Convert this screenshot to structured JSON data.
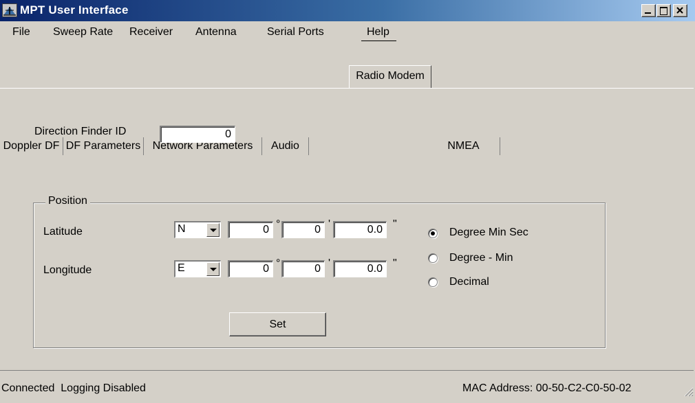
{
  "window": {
    "title": "MPT User Interface"
  },
  "menu": [
    "File",
    "Sweep Rate",
    "Receiver",
    "Antenna",
    "Serial Ports",
    "Help"
  ],
  "tabs": [
    "Doppler DF",
    "DF Parameters",
    "Network Parameters",
    "Audio",
    "Radio Modem",
    "NMEA"
  ],
  "selected_tab": "Radio Modem",
  "form": {
    "df_id_label": "Direction Finder ID",
    "df_id_value": "0",
    "position_group": "Position",
    "latitude": {
      "label": "Latitude",
      "hemisphere": "N",
      "deg": "0",
      "min": "0",
      "sec": "0.0"
    },
    "longitude": {
      "label": "Longitude",
      "hemisphere": "E",
      "deg": "0",
      "min": "0",
      "sec": "0.0"
    },
    "units": {
      "deg": "°",
      "min": "'",
      "sec": "\""
    },
    "format_options": [
      "Degree Min Sec",
      "Degree - Min",
      "Decimal"
    ],
    "selected_format": "Degree Min Sec",
    "set_label": "Set"
  },
  "status": {
    "connection": "Connected",
    "logging": "Logging Disabled",
    "mac": "MAC Address: 00-50-C2-C0-50-02"
  }
}
